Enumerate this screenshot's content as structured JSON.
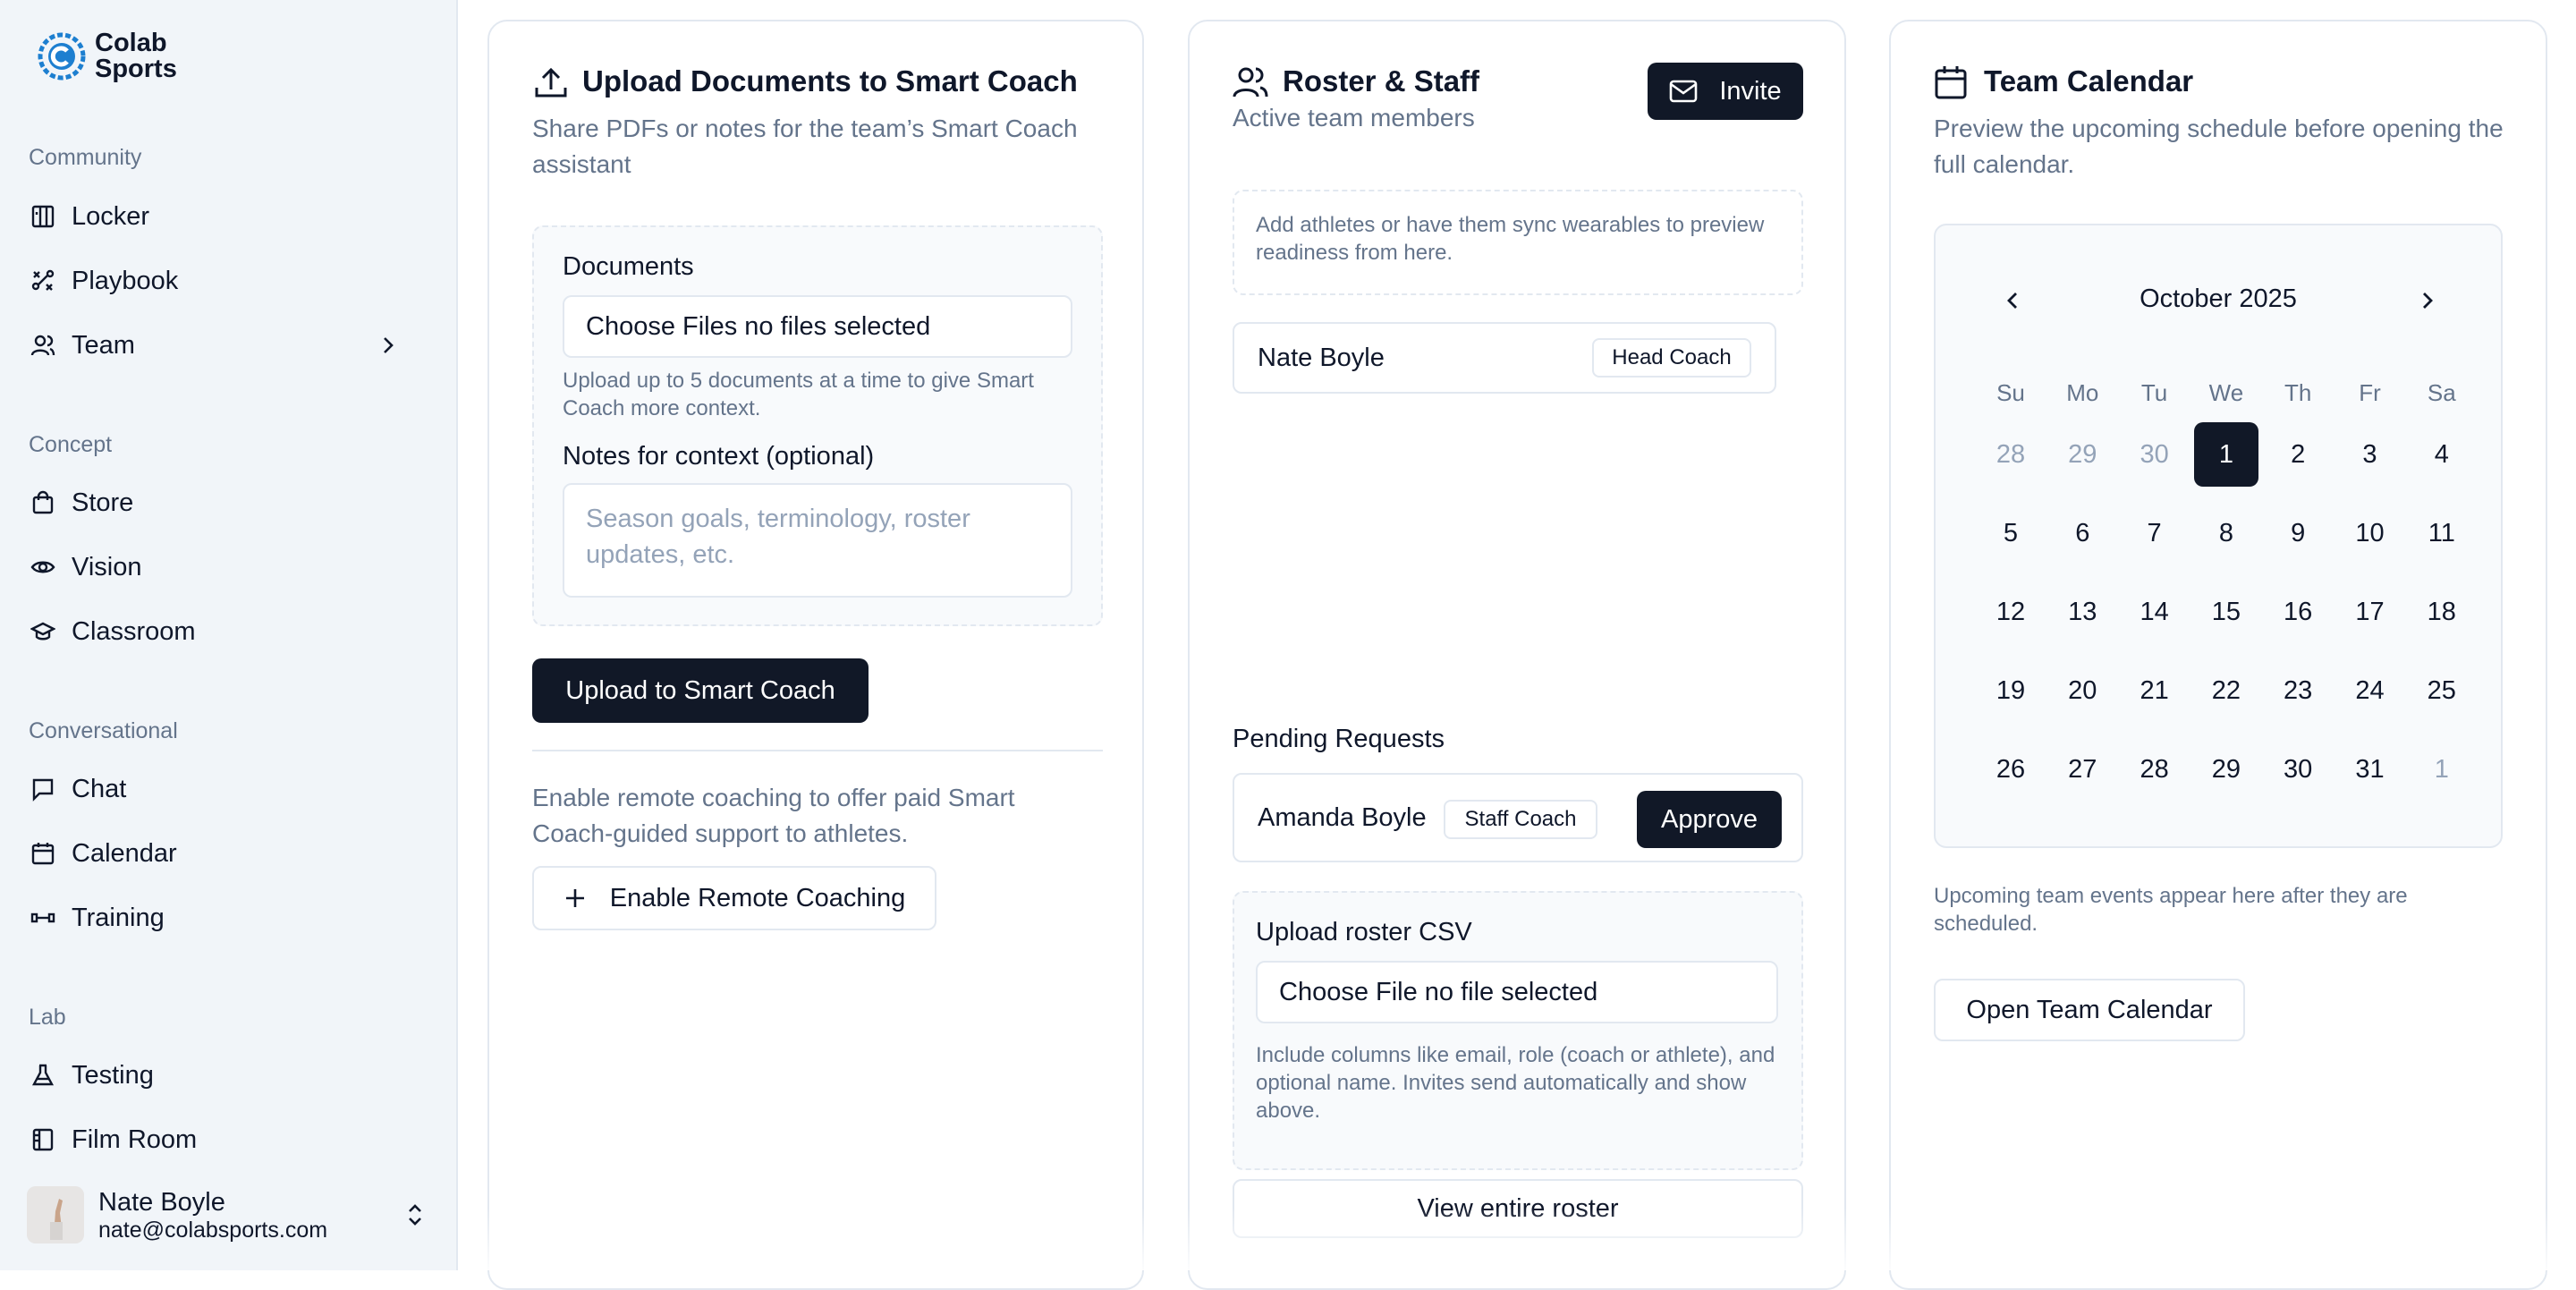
{
  "sidebar": {
    "logo_line1": "Colab",
    "logo_line2": "Sports",
    "sections": [
      {
        "label": "Community",
        "items": [
          {
            "label": "Locker",
            "icon": "locker-icon"
          },
          {
            "label": "Playbook",
            "icon": "playbook-icon"
          },
          {
            "label": "Team",
            "icon": "users-icon"
          }
        ]
      },
      {
        "label": "Concept",
        "items": [
          {
            "label": "Store",
            "icon": "store-icon"
          },
          {
            "label": "Vision",
            "icon": "eye-icon"
          },
          {
            "label": "Classroom",
            "icon": "graduation-cap-icon"
          }
        ]
      },
      {
        "label": "Conversational",
        "items": [
          {
            "label": "Chat",
            "icon": "chat-icon"
          },
          {
            "label": "Calendar",
            "icon": "calendar-icon"
          },
          {
            "label": "Training",
            "icon": "dumbbell-icon"
          }
        ]
      },
      {
        "label": "Lab",
        "items": [
          {
            "label": "Testing",
            "icon": "flask-icon"
          },
          {
            "label": "Film Room",
            "icon": "film-icon"
          }
        ]
      }
    ],
    "user": {
      "name": "Nate Boyle",
      "email": "nate@colabsports.com"
    }
  },
  "upload_card": {
    "title": "Upload Documents to Smart Coach",
    "subtitle": "Share PDFs or notes for the team’s Smart Coach assistant",
    "documents_label": "Documents",
    "file_button": "Choose Files",
    "file_status": "no files selected",
    "file_hint": "Upload up to 5 documents at a time to give Smart Coach more context.",
    "notes_label": "Notes for context (optional)",
    "notes_placeholder": "Season goals, terminology, roster updates, etc.",
    "upload_button": "Upload to Smart Coach",
    "remote_text": "Enable remote coaching to offer paid Smart Coach-guided support to athletes.",
    "remote_button": "Enable Remote Coaching"
  },
  "roster_card": {
    "title": "Roster & Staff",
    "subtitle": "Active team members",
    "invite_button": "Invite",
    "empty_hint": "Add athletes or have them sync wearables to preview readiness from here.",
    "members": [
      {
        "name": "Nate Boyle",
        "role": "Head Coach"
      }
    ],
    "pending_title": "Pending Requests",
    "pending": [
      {
        "name": "Amanda Boyle",
        "role": "Staff Coach",
        "action": "Approve"
      }
    ],
    "csv_label": "Upload roster CSV",
    "csv_button": "Choose File",
    "csv_status": "no file selected",
    "csv_hint": "Include columns like email, role (coach or athlete), and optional name. Invites send automatically and show above.",
    "view_all": "View entire roster"
  },
  "calendar_card": {
    "title": "Team Calendar",
    "subtitle": "Preview the upcoming schedule before opening the full calendar.",
    "month": "October 2025",
    "weekdays": [
      "Su",
      "Mo",
      "Tu",
      "We",
      "Th",
      "Fr",
      "Sa"
    ],
    "weeks": [
      [
        "28",
        "29",
        "30",
        "1",
        "2",
        "3",
        "4"
      ],
      [
        "5",
        "6",
        "7",
        "8",
        "9",
        "10",
        "11"
      ],
      [
        "12",
        "13",
        "14",
        "15",
        "16",
        "17",
        "18"
      ],
      [
        "19",
        "20",
        "21",
        "22",
        "23",
        "24",
        "25"
      ],
      [
        "26",
        "27",
        "28",
        "29",
        "30",
        "31",
        "1"
      ]
    ],
    "selected_day": "1",
    "events_text": "Upcoming team events appear here after they are scheduled.",
    "open_button": "Open Team Calendar"
  },
  "colors": {
    "primary": "#111827",
    "sidebar_bg": "#f1f5f9",
    "muted_text": "#64748b",
    "border": "#e2e8f0",
    "logo_blue": "#1d7fd0"
  }
}
